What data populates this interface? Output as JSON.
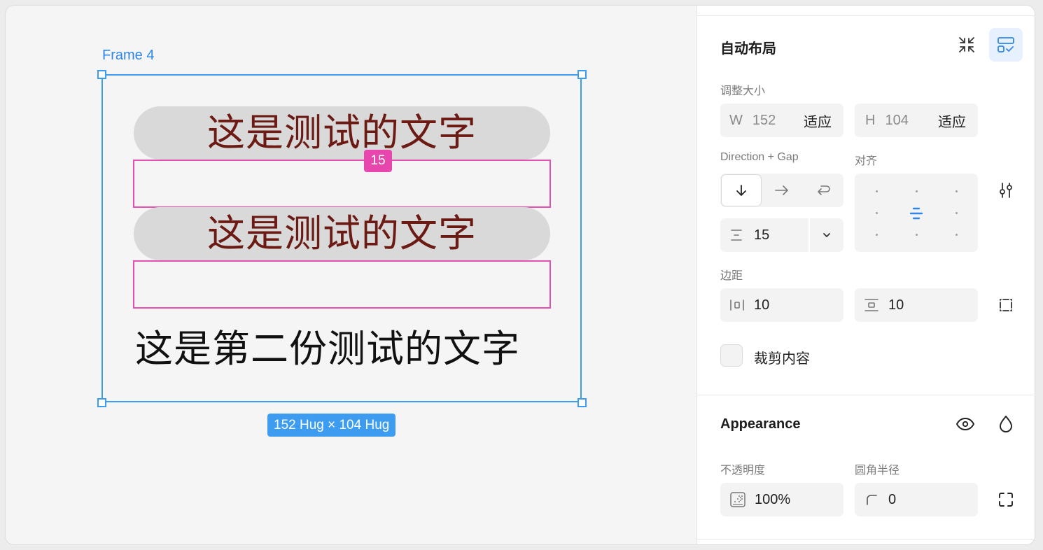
{
  "canvas": {
    "frame_label": "Frame 4",
    "pill_1_text": "这是测试的文字",
    "pill_2_text": "这是测试的文字",
    "plain_text": "这是第二份测试的文字",
    "gap_badge": "15",
    "size_badge": "152 Hug × 104 Hug"
  },
  "panel": {
    "auto_layout": {
      "title": "自动布局",
      "resize_label": "调整大小",
      "width_prefix": "W",
      "width_value": "152",
      "width_mode": "适应",
      "height_prefix": "H",
      "height_value": "104",
      "height_mode": "适应",
      "direction_label": "Direction + Gap",
      "align_label": "对齐",
      "gap_value": "15",
      "padding_label": "边距",
      "padding_h": "10",
      "padding_v": "10",
      "clip_label": "裁剪内容"
    },
    "appearance": {
      "title": "Appearance",
      "opacity_label": "不透明度",
      "opacity_value": "100%",
      "radius_label": "圆角半径",
      "radius_value": "0"
    }
  },
  "colors": {
    "selection": "#3d9cf0",
    "gap_highlight": "#e747ad",
    "pill_text": "#6b1a14",
    "pill_bg": "#d9d9d9",
    "accent": "#2e86ea"
  }
}
